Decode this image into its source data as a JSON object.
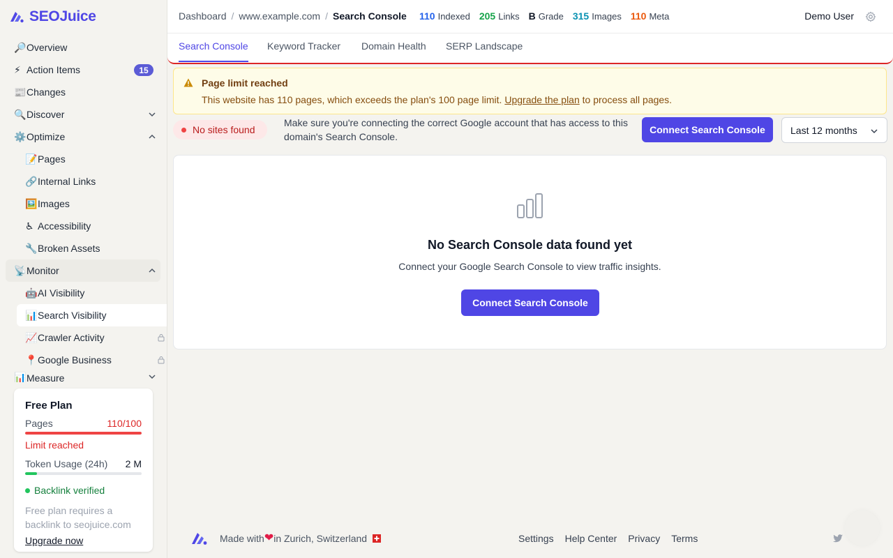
{
  "brand": {
    "name": "SEOJuice"
  },
  "sidebar": {
    "items": [
      {
        "emoji": "🔎",
        "label": "Overview"
      },
      {
        "emoji": "⚡",
        "label": "Action Items",
        "badge": "15"
      },
      {
        "emoji": "📰",
        "label": "Changes"
      },
      {
        "emoji": "🔍",
        "label": "Discover"
      },
      {
        "emoji": "⚙️",
        "label": "Optimize"
      },
      {
        "emoji": "📝",
        "label": "Pages"
      },
      {
        "emoji": "🔗",
        "label": "Internal Links"
      },
      {
        "emoji": "🖼️",
        "label": "Images"
      },
      {
        "emoji": "♿",
        "label": "Accessibility"
      },
      {
        "emoji": "🔧",
        "label": "Broken Assets"
      },
      {
        "emoji": "📡",
        "label": "Monitor"
      },
      {
        "emoji": "🤖",
        "label": "AI Visibility"
      },
      {
        "emoji": "📊",
        "label": "Search Visibility"
      },
      {
        "emoji": "📈",
        "label": "Crawler Activity"
      },
      {
        "emoji": "📍",
        "label": "Google Business"
      },
      {
        "emoji": "📊",
        "label": "Measure"
      }
    ]
  },
  "plan": {
    "title": "Free Plan",
    "pages_label": "Pages",
    "pages_value": "110/100",
    "pages_fraction": 1.0,
    "limit_text": "Limit reached",
    "token_label": "Token Usage (24h)",
    "token_value": "2 M",
    "token_fraction": 0.1,
    "verified_text": "Backlink verified",
    "note": "Free plan requires a backlink to seojuice.com",
    "upgrade_label": "Upgrade now"
  },
  "header": {
    "breadcrumb": [
      "Dashboard",
      "www.example.com",
      "Search Console"
    ],
    "stats": [
      {
        "num": "110",
        "label": "Indexed",
        "color": "#2563eb"
      },
      {
        "num": "205",
        "label": "Links",
        "color": "#16a34a"
      },
      {
        "num": "B",
        "label": "Grade",
        "color": "#111827"
      },
      {
        "num": "315",
        "label": "Images",
        "color": "#0891b2"
      },
      {
        "num": "110",
        "label": "Meta",
        "color": "#ea580c"
      }
    ],
    "user": "Demo User"
  },
  "tabs": [
    "Search Console",
    "Keyword Tracker",
    "Domain Health",
    "SERP Landscape"
  ],
  "alert": {
    "title": "Page limit reached",
    "text_before": "This website has 110 pages, which exceeds the plan's 100 page limit. ",
    "link": "Upgrade the plan",
    "text_after": " to process all pages."
  },
  "status": {
    "pill": "No sites found",
    "hint": "Make sure you're connecting the correct Google account that has access to this domain's Search Console.",
    "connect_label": "Connect Search Console",
    "range": "Last 12 months"
  },
  "empty": {
    "title": "No Search Console data found yet",
    "subtitle": "Connect your Google Search Console to view traffic insights.",
    "button": "Connect Search Console"
  },
  "footer": {
    "made_prefix": "Made with ",
    "made_suffix": "in Zurich, Switzerland",
    "links": [
      "Settings",
      "Help Center",
      "Privacy",
      "Terms"
    ]
  },
  "colors": {
    "accent": "#4f46e5",
    "danger": "#dc2626",
    "success": "#16a34a"
  }
}
